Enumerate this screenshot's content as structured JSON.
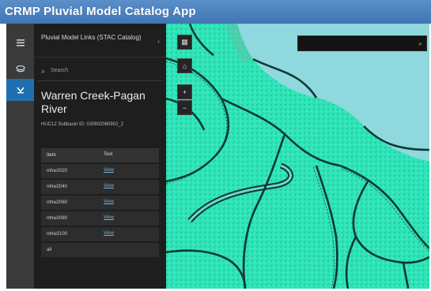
{
  "app": {
    "title": "CRMP Pluvial Model Catalog App"
  },
  "rail": {
    "items": [
      {
        "icon": "list-icon"
      },
      {
        "icon": "layers-icon"
      },
      {
        "icon": "catalog-icon",
        "active": true
      }
    ]
  },
  "panel": {
    "title": "Pluvial Model Links (STAC Catalog)",
    "search_placeholder": "Search",
    "model_name": "Warren Creek-Pagan River",
    "model_id": "HUC12 Subbasin ID: 020802060902_2",
    "table": {
      "headers": [
        "Item",
        "Tool"
      ],
      "rows": [
        {
          "item": "mhw2020",
          "tool": "View"
        },
        {
          "item": "mhw2040",
          "tool": "View"
        },
        {
          "item": "mhw2060",
          "tool": "View"
        },
        {
          "item": "mhw2080",
          "tool": "View"
        },
        {
          "item": "mhw2100",
          "tool": "View"
        },
        {
          "item": "all",
          "tool": ""
        }
      ]
    }
  },
  "map": {
    "tools": [
      {
        "name": "basemap-toggle-button",
        "glyph": "▦"
      },
      {
        "name": "home-button",
        "glyph": "⌂"
      },
      {
        "name": "zoom-in-button",
        "glyph": "+"
      },
      {
        "name": "zoom-out-button",
        "glyph": "−"
      }
    ],
    "search_placeholder": "",
    "colors": {
      "flood": "#2fe5b9",
      "water": "#8fd8de",
      "boundary": "#0b3a33"
    }
  },
  "colors": {
    "title_bar": "#4a82c1",
    "panel": "#1e1e1e",
    "rail": "#3a3a3a",
    "rail_active": "#1f6fb0",
    "link": "#6fb7e8"
  }
}
